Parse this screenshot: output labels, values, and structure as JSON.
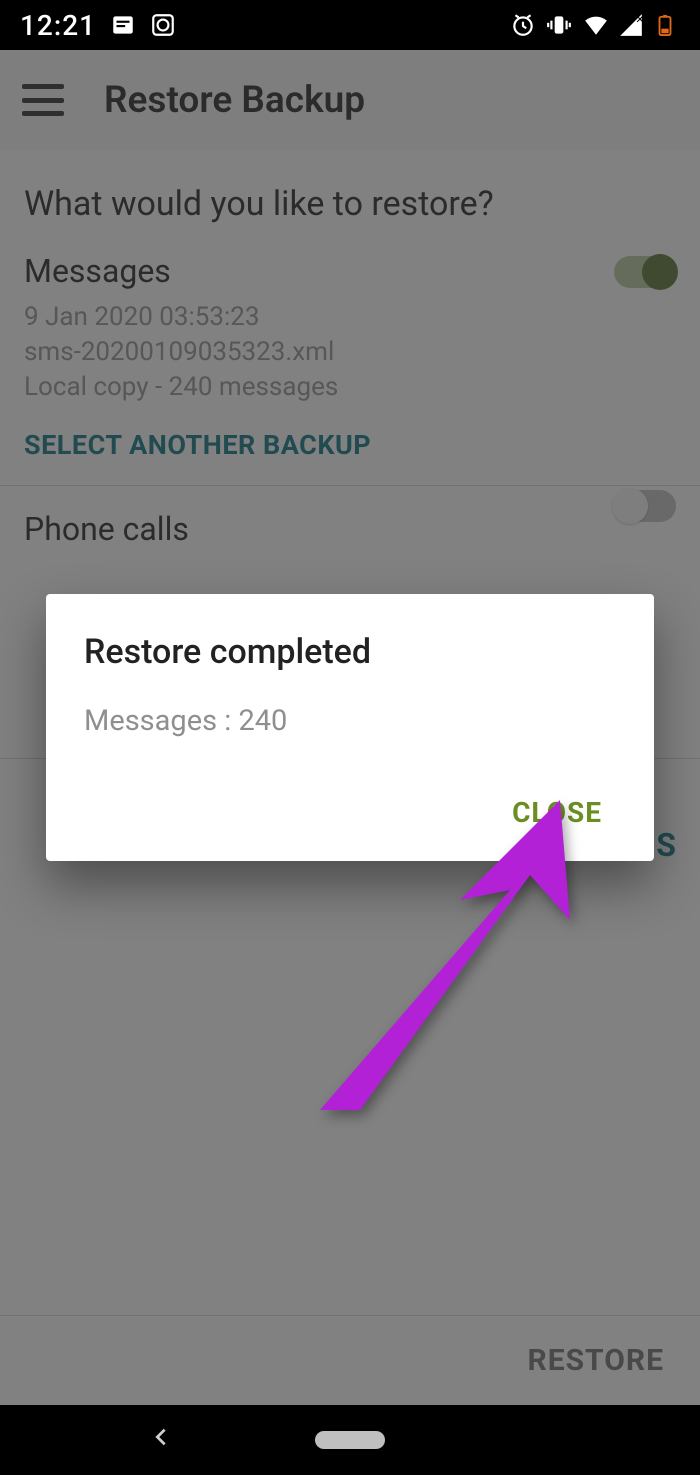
{
  "statusbar": {
    "time": "12:21"
  },
  "appbar": {
    "title": "Restore Backup"
  },
  "question": "What would you like to restore?",
  "messages_section": {
    "title": "Messages",
    "timestamp": "9 Jan 2020 03:53:23",
    "filename": "sms-20200109035323.xml",
    "summary": "Local copy - 240 messages",
    "select_another": "SELECT ANOTHER BACKUP",
    "toggle_on": true
  },
  "phone_section": {
    "title": "Phone calls",
    "toggle_on": false
  },
  "peek_link_suffix": "S",
  "footer": {
    "restore": "RESTORE"
  },
  "dialog": {
    "title": "Restore completed",
    "body": "Messages  :  240",
    "close": "CLOSE"
  },
  "colors": {
    "accent_link": "#0b6e7a",
    "dialog_action": "#6b8e23",
    "arrow": "#b321d6"
  }
}
